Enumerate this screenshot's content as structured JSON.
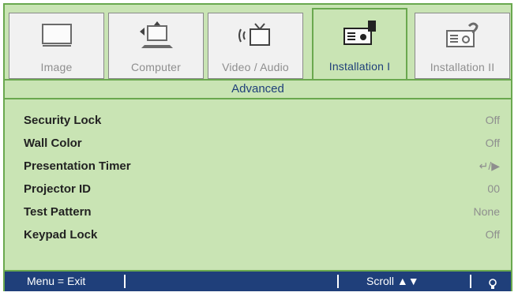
{
  "tabs": [
    {
      "label": "Image",
      "icon": "monitor-icon",
      "active": false
    },
    {
      "label": "Computer",
      "icon": "computer-icon",
      "active": false
    },
    {
      "label": "Video / Audio",
      "icon": "video-audio-icon",
      "active": false
    },
    {
      "label": "Installation I",
      "icon": "projector-icon",
      "active": true
    },
    {
      "label": "Installation II",
      "icon": "projector-settings-icon",
      "active": false
    }
  ],
  "section_title": "Advanced",
  "items": [
    {
      "label": "Security Lock",
      "value": "Off"
    },
    {
      "label": "Wall Color",
      "value": "Off"
    },
    {
      "label": "Presentation Timer",
      "value": "↵/▶"
    },
    {
      "label": "Projector ID",
      "value": "00"
    },
    {
      "label": "Test Pattern",
      "value": "None"
    },
    {
      "label": "Keypad Lock",
      "value": "Off"
    }
  ],
  "statusbar": {
    "menu_hint": "Menu = Exit",
    "scroll_hint": "Scroll ▲▼",
    "bulb_icon": "lightbulb-icon"
  },
  "colors": {
    "panel_bg": "#c9e4b4",
    "border": "#6aa84f",
    "accent_text": "#1f3f7a",
    "statusbar_bg": "#1f3f7a",
    "inactive_text": "#8e8e8e"
  }
}
